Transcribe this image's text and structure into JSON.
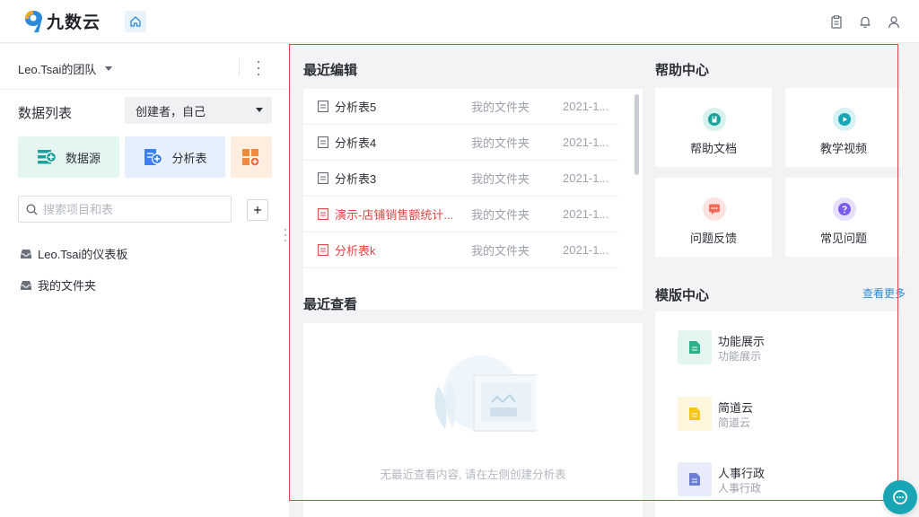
{
  "app": {
    "name": "九数云"
  },
  "topbar": {
    "icons": [
      "home-icon",
      "clipboard-icon",
      "bell-icon",
      "user-icon"
    ]
  },
  "sidebar": {
    "team_name": "Leo.Tsai的团队",
    "list_title": "数据列表",
    "filter_value": "创建者，自己",
    "create_buttons": [
      {
        "label": "数据源",
        "icon": "datasource-add-icon",
        "color": "#1aa39a"
      },
      {
        "label": "分析表",
        "icon": "analysis-add-icon",
        "color": "#3b7ff0"
      },
      {
        "label": "",
        "icon": "dashboard-add-icon",
        "color": "#f08a3c"
      }
    ],
    "search_placeholder": "搜索项目和表",
    "tree": [
      {
        "label": "Leo.Tsai的仪表板",
        "icon": "inbox-icon"
      },
      {
        "label": "我的文件夹",
        "icon": "inbox-icon"
      }
    ]
  },
  "recent_edit": {
    "title": "最近编辑",
    "rows": [
      {
        "name": "分析表5",
        "folder": "我的文件夹",
        "date": "2021-1...",
        "color": "#2b2f36"
      },
      {
        "name": "分析表4",
        "folder": "我的文件夹",
        "date": "2021-1...",
        "color": "#2b2f36"
      },
      {
        "name": "分析表3",
        "folder": "我的文件夹",
        "date": "2021-1...",
        "color": "#2b2f36"
      },
      {
        "name": "演示-店铺销售额统计...",
        "folder": "我的文件夹",
        "date": "2021-1...",
        "color": "#e04545"
      },
      {
        "name": "分析表k",
        "folder": "我的文件夹",
        "date": "2021-1...",
        "color": "#e04545"
      }
    ]
  },
  "recent_view": {
    "title": "最近查看",
    "empty_text": "无最近查看内容, 请在左侧创建分析表"
  },
  "help": {
    "title": "帮助中心",
    "tiles": [
      {
        "label": "帮助文档",
        "icon": "document-icon",
        "color": "#1aa39a"
      },
      {
        "label": "教学视频",
        "icon": "video-icon",
        "color": "#19a6b4"
      },
      {
        "label": "问题反馈",
        "icon": "feedback-icon",
        "color": "#f06b5a"
      },
      {
        "label": "常见问题",
        "icon": "question-icon",
        "color": "#7b5cf0"
      }
    ]
  },
  "templates": {
    "title": "模版中心",
    "see_more": "查看更多",
    "items": [
      {
        "title": "功能展示",
        "subtitle": "功能展示",
        "icon": "green-doc-icon",
        "color": "#2bb28a"
      },
      {
        "title": "简道云",
        "subtitle": "简道云",
        "icon": "yellow-doc-icon",
        "color": "#f5c518"
      },
      {
        "title": "人事行政",
        "subtitle": "人事行政",
        "icon": "blue-doc-icon",
        "color": "#6b7fd7"
      }
    ]
  },
  "accent": "#2d8ad6",
  "highlight_color": "#e04545"
}
